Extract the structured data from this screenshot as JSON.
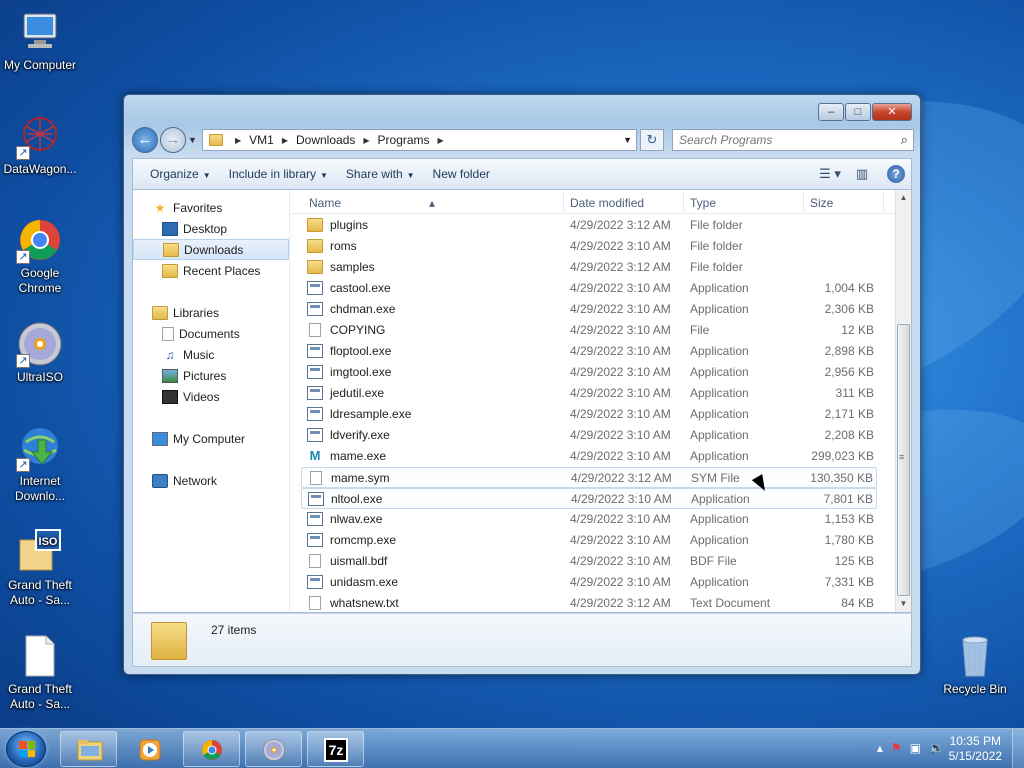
{
  "desktop": {
    "icons": [
      {
        "label": "My Computer",
        "icon": "computer-icon"
      },
      {
        "label": "DataWagon...",
        "icon": "datawagon-icon"
      },
      {
        "label": "Google Chrome",
        "icon": "chrome-icon"
      },
      {
        "label": "UltraISO",
        "icon": "disc-icon"
      },
      {
        "label": "Internet Downlo...",
        "icon": "idm-icon"
      },
      {
        "label": "Grand Theft Auto - Sa...",
        "icon": "iso-icon"
      },
      {
        "label": "Grand Theft Auto - Sa...",
        "icon": "file-icon"
      },
      {
        "label": "Recycle Bin",
        "icon": "recycle-bin-icon"
      }
    ]
  },
  "explorer": {
    "address": {
      "segments": [
        "VM1",
        "Downloads",
        "Programs"
      ]
    },
    "search": {
      "placeholder": "Search Programs"
    },
    "toolbar": {
      "organize": "Organize",
      "include_library": "Include in library",
      "share_with": "Share with",
      "new_folder": "New folder"
    },
    "navpane": {
      "favorites": "Favorites",
      "desktop": "Desktop",
      "downloads": "Downloads",
      "recent_places": "Recent Places",
      "libraries": "Libraries",
      "documents": "Documents",
      "music": "Music",
      "pictures": "Pictures",
      "videos": "Videos",
      "my_computer": "My Computer",
      "network": "Network"
    },
    "columns": {
      "name": "Name",
      "date": "Date modified",
      "type": "Type",
      "size": "Size"
    },
    "files": [
      {
        "name": "plugins",
        "date": "4/29/2022 3:12 AM",
        "type": "File folder",
        "size": "",
        "icon": "folder-icon"
      },
      {
        "name": "roms",
        "date": "4/29/2022 3:10 AM",
        "type": "File folder",
        "size": "",
        "icon": "folder-icon"
      },
      {
        "name": "samples",
        "date": "4/29/2022 3:12 AM",
        "type": "File folder",
        "size": "",
        "icon": "folder-icon"
      },
      {
        "name": "castool.exe",
        "date": "4/29/2022 3:10 AM",
        "type": "Application",
        "size": "1,004 KB",
        "icon": "app-icon"
      },
      {
        "name": "chdman.exe",
        "date": "4/29/2022 3:10 AM",
        "type": "Application",
        "size": "2,306 KB",
        "icon": "app-icon"
      },
      {
        "name": "COPYING",
        "date": "4/29/2022 3:10 AM",
        "type": "File",
        "size": "12 KB",
        "icon": "document-icon"
      },
      {
        "name": "floptool.exe",
        "date": "4/29/2022 3:10 AM",
        "type": "Application",
        "size": "2,898 KB",
        "icon": "app-icon"
      },
      {
        "name": "imgtool.exe",
        "date": "4/29/2022 3:10 AM",
        "type": "Application",
        "size": "2,956 KB",
        "icon": "app-icon"
      },
      {
        "name": "jedutil.exe",
        "date": "4/29/2022 3:10 AM",
        "type": "Application",
        "size": "311 KB",
        "icon": "app-icon"
      },
      {
        "name": "ldresample.exe",
        "date": "4/29/2022 3:10 AM",
        "type": "Application",
        "size": "2,171 KB",
        "icon": "app-icon"
      },
      {
        "name": "ldverify.exe",
        "date": "4/29/2022 3:10 AM",
        "type": "Application",
        "size": "2,208 KB",
        "icon": "app-icon"
      },
      {
        "name": "mame.exe",
        "date": "4/29/2022 3:10 AM",
        "type": "Application",
        "size": "299,023 KB",
        "icon": "mame-icon"
      },
      {
        "name": "mame.sym",
        "date": "4/29/2022 3:12 AM",
        "type": "SYM File",
        "size": "130,350 KB",
        "icon": "document-icon"
      },
      {
        "name": "nltool.exe",
        "date": "4/29/2022 3:10 AM",
        "type": "Application",
        "size": "7,801 KB",
        "icon": "app-icon"
      },
      {
        "name": "nlwav.exe",
        "date": "4/29/2022 3:10 AM",
        "type": "Application",
        "size": "1,153 KB",
        "icon": "app-icon"
      },
      {
        "name": "romcmp.exe",
        "date": "4/29/2022 3:10 AM",
        "type": "Application",
        "size": "1,780 KB",
        "icon": "app-icon"
      },
      {
        "name": "uismall.bdf",
        "date": "4/29/2022 3:10 AM",
        "type": "BDF File",
        "size": "125 KB",
        "icon": "document-icon"
      },
      {
        "name": "unidasm.exe",
        "date": "4/29/2022 3:10 AM",
        "type": "Application",
        "size": "7,331 KB",
        "icon": "app-icon"
      },
      {
        "name": "whatsnew.txt",
        "date": "4/29/2022 3:12 AM",
        "type": "Text Document",
        "size": "84 KB",
        "icon": "text-document-icon"
      }
    ],
    "details": {
      "count": "27 items"
    }
  },
  "taskbar": {
    "apps": [
      "explorer-icon",
      "media-player-icon",
      "chrome-icon",
      "ultraiso-icon",
      "7zip-icon"
    ],
    "sevenzip_label": "7z",
    "clock": {
      "time": "10:35 PM",
      "date": "5/15/2022"
    }
  },
  "colors": {
    "accent": "#1f6fc8",
    "selection": "#d5e6f8",
    "close": "#c8452c"
  }
}
